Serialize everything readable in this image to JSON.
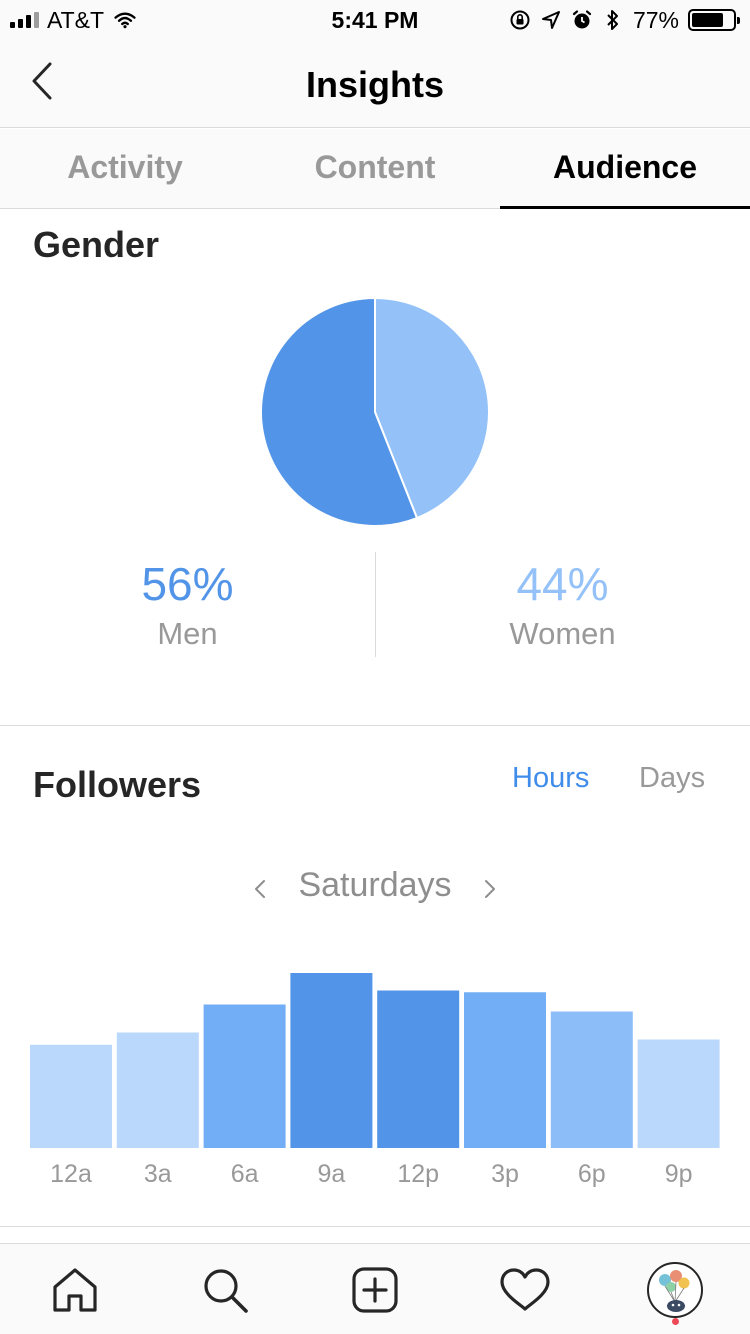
{
  "status_bar": {
    "carrier": "AT&T",
    "time": "5:41 PM",
    "battery_percent": "77%",
    "battery_level": 0.77,
    "signal_bars": 4,
    "signal_bars_active": 3,
    "icons": [
      "wifi-icon",
      "orientation-lock-icon",
      "location-icon",
      "alarm-icon",
      "bluetooth-icon"
    ]
  },
  "header": {
    "title": "Insights",
    "back_icon": "chevron-left-icon"
  },
  "tabs": [
    {
      "label": "Activity",
      "active": false
    },
    {
      "label": "Content",
      "active": false
    },
    {
      "label": "Audience",
      "active": true
    }
  ],
  "gender": {
    "title": "Gender",
    "men": {
      "percent": "56%",
      "label": "Men",
      "color": "#5294e8"
    },
    "women": {
      "percent": "44%",
      "label": "Women",
      "color": "#94c2f8"
    }
  },
  "followers": {
    "title": "Followers",
    "toggle": {
      "hours": "Hours",
      "days": "Days",
      "selected": "hours",
      "selected_color": "#3f8cea"
    },
    "day": "Saturdays"
  },
  "chart_data": [
    {
      "type": "pie",
      "title": "Gender",
      "categories": [
        "Men",
        "Women"
      ],
      "values": [
        56,
        44
      ],
      "colors": [
        "#5294e8",
        "#94c2f8"
      ]
    },
    {
      "type": "bar",
      "title": "Followers",
      "categories": [
        "12a",
        "3a",
        "6a",
        "9a",
        "12p",
        "3p",
        "6p",
        "9p"
      ],
      "values": [
        59,
        66,
        82,
        100,
        90,
        89,
        78,
        62
      ],
      "colors": [
        "#bad8fb",
        "#bad8fb",
        "#72aef6",
        "#5294e8",
        "#5294e8",
        "#72aef6",
        "#8cbdf8",
        "#bad8fb"
      ],
      "ylim": [
        0,
        100
      ]
    }
  ],
  "bottom_nav": [
    {
      "name": "home-icon"
    },
    {
      "name": "search-icon"
    },
    {
      "name": "new-post-icon"
    },
    {
      "name": "activity-heart-icon"
    },
    {
      "name": "profile-avatar"
    }
  ]
}
